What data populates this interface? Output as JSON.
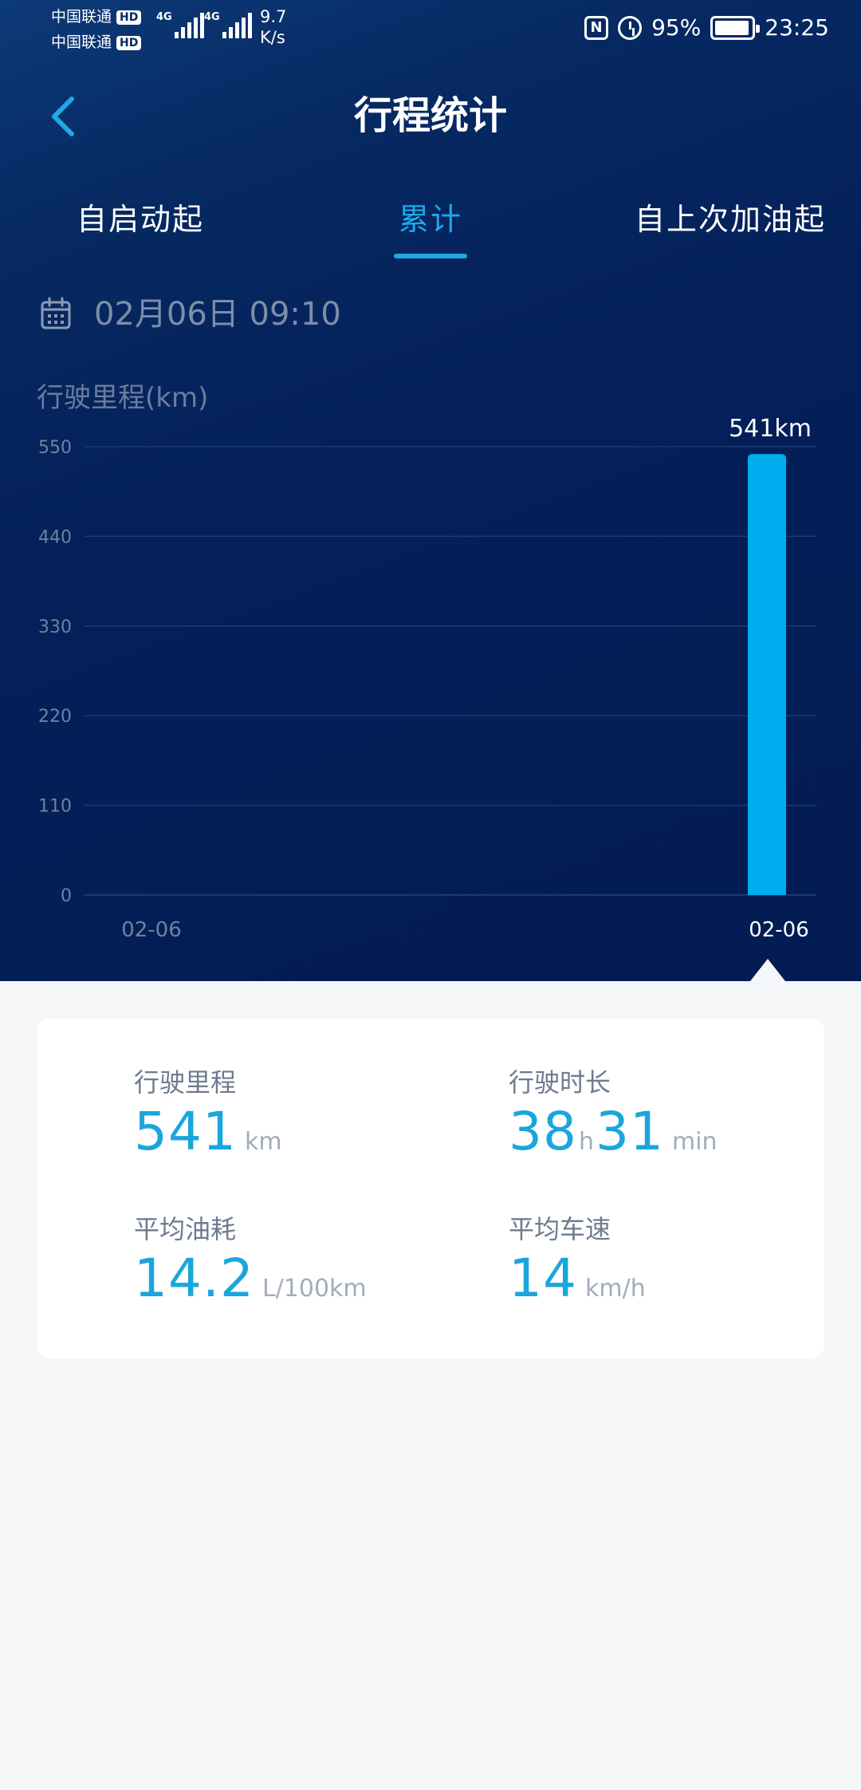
{
  "status_bar": {
    "carrier_1": "中国联通",
    "carrier_2": "中国联通",
    "hd_badge": "HD",
    "network_1": "4G",
    "network_2": "4G",
    "speed_value": "9.7",
    "speed_unit": "K/s",
    "nfc_icon": "nfc-icon",
    "alarm_icon": "alarm-icon",
    "battery_percent": "95%",
    "battery_level": 0.95,
    "time": "23:25"
  },
  "header": {
    "title": "行程统计",
    "back_icon": "chevron-left-icon"
  },
  "tabs": [
    {
      "label": "自启动起",
      "active": false
    },
    {
      "label": "累计",
      "active": true
    },
    {
      "label": "自上次加油起",
      "active": false
    }
  ],
  "date": {
    "icon": "calendar-icon",
    "text": "02月06日 09:10"
  },
  "chart_data": {
    "type": "bar",
    "ylabel": "行驶里程(km)",
    "ylim": [
      0,
      550
    ],
    "yticks": [
      0,
      110,
      220,
      330,
      440,
      550
    ],
    "ytick_labels": [
      "0",
      "110",
      "220",
      "330",
      "440",
      "550"
    ],
    "xtick_labels": [
      "02-06",
      "02-06"
    ],
    "categories": [
      "02-06"
    ],
    "values": [
      541
    ],
    "data_label": "541km",
    "grid": true,
    "colors": {
      "bar": "#00aeef",
      "grid": "#1a3a74",
      "axis_text": "#6f82a0",
      "active_tick": "#ffffff"
    }
  },
  "stats": {
    "mileage": {
      "label": "行驶里程",
      "value": "541",
      "unit": "km"
    },
    "duration": {
      "label": "行驶时长",
      "hours": "38",
      "hours_unit": "h",
      "minutes": "31",
      "minutes_unit": "min"
    },
    "fuel": {
      "label": "平均油耗",
      "value": "14.2",
      "unit": "L/100km"
    },
    "speed": {
      "label": "平均车速",
      "value": "14",
      "unit": "km/h"
    }
  },
  "colors": {
    "accent": "#1fa8e8",
    "stat_value": "#1aa6dc",
    "hero_bg": "#04205a",
    "page_bg": "#f5f6f8"
  }
}
